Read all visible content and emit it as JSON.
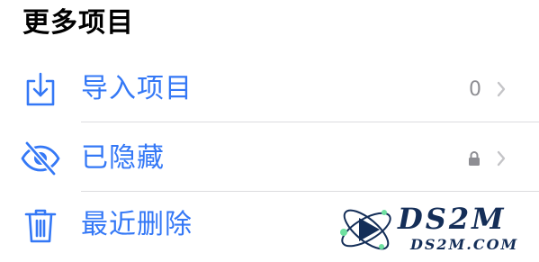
{
  "section": {
    "title": "更多项目"
  },
  "rows": [
    {
      "label": "导入项目",
      "icon": "import-tray-icon",
      "count": "0",
      "trailing_icon": "chevron-right-icon"
    },
    {
      "label": "已隐藏",
      "icon": "eye-slash-icon",
      "trailing_status_icon": "lock-icon",
      "trailing_icon": "chevron-right-icon"
    },
    {
      "label": "最近删除",
      "icon": "trash-icon"
    }
  ],
  "watermark": {
    "title": "DS2M",
    "url": "DS2M.COM"
  },
  "colors": {
    "accent": "#3478f6",
    "secondary_text": "#8e8e93",
    "separator": "#dcdcdf",
    "watermark": "#142e58"
  }
}
